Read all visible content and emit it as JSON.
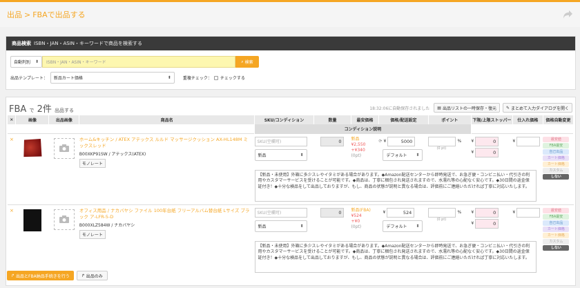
{
  "breadcrumb": {
    "root": "出品",
    "sep": ">",
    "current": "FBAで出品する"
  },
  "search": {
    "title": "商品検索",
    "subtitle": "ISBN・JAN・ASIN・キーワードで商品を検索する",
    "mode_value": "自動判別",
    "placeholder": "ISBN・JAN・ASIN・キーワード",
    "button": "検索",
    "template_label": "出品テンプレート：",
    "template_value": "新品カート価格",
    "dup_label": "重複チェック：",
    "dup_check": "チェックする"
  },
  "list": {
    "fba": "FBA",
    "de": "で",
    "count": "2件",
    "suffix": "出品する",
    "autosave": "18:32:06に自動保存されました",
    "save_button": "出品リストの一時保存・復元",
    "dialog_button": "まとめて入力ダイアログを開く"
  },
  "columns": [
    "画像",
    "出品画像",
    "商品名",
    "SKU/コンディション",
    "数量",
    "最安価格",
    "価格/配送設定",
    "ポイント",
    "下限/上限ストッパー",
    "仕入れ価格",
    "価格自動変更"
  ],
  "sub_column": "コンディション説明",
  "status_labels": [
    "最安値",
    "FBA最安",
    "自己出品",
    "カート価格",
    "カート価格",
    "カスタム",
    "しない"
  ],
  "products": [
    {
      "name": "ホーム&キッチン / ATEX アテックス ルルド マッサージクッション AX-HL148M ミックスレッド",
      "asin": "B00XKP91SW / アテックス(ATEX)",
      "mono": "モノレート",
      "sku_placeholder": "SKU(空欄可)",
      "condition": "新品",
      "qty": "0",
      "low_label": "新品",
      "low_price": "¥2,550",
      "low_ship": "+¥340",
      "low_pt": "(0pt)",
      "price": "5000",
      "ship_mode": "デフォルト",
      "point_unit": "%",
      "point_pt": "(0 pt)",
      "lower": "0",
      "upper": "0",
      "description": "【新品・未使用】外箱に多少スレやイタミがある場合があります。◆Amazon配送センターから即時発送で、お急ぎ便・コンビニ払い・代引きの利用やカスタマーサービスを受けることが可能です。◆商品は、丁寧に梱包され発送されますので、水濡れ等の心配なく安心です。◆30日間の返金保証付き！◆十分な検品をして出品しておりますが、もし、商品の状態が説明と異なる場合は、評価前にご連絡いただければ丁寧に対応いたします。"
    },
    {
      "name": "オフィス用品 / ナカバヤシ ファイル 100年台紙 フリーアルバム替台紙 Lサイズ ブラック ア-LFR-5-D",
      "asin": "B000XLZ584W / ナカバヤシ",
      "mono": "モノレート",
      "sku_placeholder": "SKU(空欄可)",
      "condition": "新品",
      "qty": "0",
      "low_label": "新品(FBA)",
      "low_price": "¥524",
      "low_ship": "+¥0",
      "low_pt": "(0pt)",
      "price": "524",
      "ship_mode": "デフォルト",
      "point_unit": "%",
      "point_pt": "(0 pt)",
      "lower": "0",
      "upper": "0",
      "description": "【新品・未使用】外箱に多少スレやイタミがある場合があります。◆Amazon配送センターから即時発送で、お急ぎ便・コンビニ払い・代引きの利用やカスタマーサービスを受けることが可能です。◆商品は、丁寧に梱包され発送されますので、水濡れ等の心配なく安心です。◆30日間の返金保証付き！◆十分な検品をして出品しておりますが、もし、商品の状態が説明と異なる場合は、評価前にご連絡いただければ丁寧に対応いたします。"
    }
  ],
  "actions": {
    "fba_button": "出品とFBA納品手続きを行う",
    "list_only": "出品のみ"
  },
  "icons": {
    "x": "×",
    "yen": "¥",
    "refresh": "⟳",
    "arrow": "↱"
  }
}
